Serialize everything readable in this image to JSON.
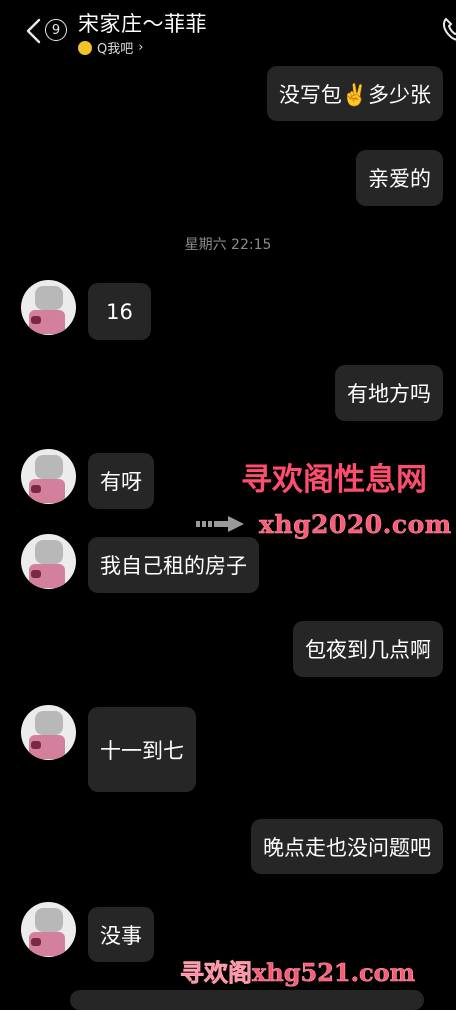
{
  "header": {
    "unread_count": "9",
    "title": "宋家庄～菲菲",
    "subtitle": "Q我吧"
  },
  "timestamp": "星期六 22:15",
  "messages": [
    {
      "side": "right",
      "text": "没写包✌️多少张"
    },
    {
      "side": "right",
      "text": "亲爱的"
    },
    {
      "side": "left",
      "text": "16"
    },
    {
      "side": "right",
      "text": "有地方吗"
    },
    {
      "side": "left",
      "text": "有呀"
    },
    {
      "side": "left",
      "text": "我自己租的房子"
    },
    {
      "side": "right",
      "text": "包夜到几点啊"
    },
    {
      "side": "left",
      "text": "十一到七"
    },
    {
      "side": "right",
      "text": "晚点走也没问题吧"
    },
    {
      "side": "left",
      "text": "没事"
    }
  ],
  "watermarks": [
    "寻欢阁性息网",
    "xhg2020.com",
    "寻欢阁xhg521.com"
  ],
  "colors": {
    "background": "#000000",
    "bubble": "#262626",
    "watermark": "#ff4d6d"
  }
}
